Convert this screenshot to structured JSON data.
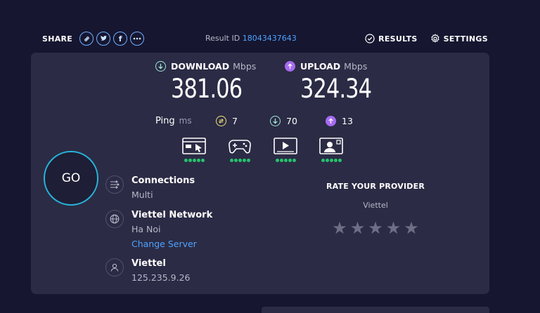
{
  "share": {
    "label": "SHARE",
    "buttons": [
      {
        "name": "link",
        "icon": "link-icon"
      },
      {
        "name": "twitter",
        "icon": "twitter-icon"
      },
      {
        "name": "facebook",
        "icon": "facebook-icon",
        "glyph": "f"
      },
      {
        "name": "more",
        "icon": "more-icon"
      }
    ]
  },
  "result": {
    "label": "Result ID",
    "id": "18043437643"
  },
  "nav": {
    "results": "RESULTS",
    "settings": "SETTINGS"
  },
  "download": {
    "label": "DOWNLOAD",
    "unit": "Mbps",
    "value": "381.06",
    "icon": "arrow-down-icon",
    "color": "#9fe8d6"
  },
  "upload": {
    "label": "UPLOAD",
    "unit": "Mbps",
    "value": "324.34",
    "icon": "arrow-up-icon",
    "color": "#c58cff"
  },
  "ping": {
    "label": "Ping",
    "unit": "ms",
    "idle": {
      "value": "7",
      "color": "#f1e37a"
    },
    "download": {
      "value": "70",
      "color": "#9fe8d6"
    },
    "upload": {
      "value": "13",
      "color": "#c58cff"
    }
  },
  "app_ratings": [
    {
      "name": "web-browsing",
      "icon": "browser-icon",
      "rating": 5,
      "max": 5
    },
    {
      "name": "gaming",
      "icon": "gamepad-icon",
      "rating": 5,
      "max": 5
    },
    {
      "name": "video-streaming",
      "icon": "video-icon",
      "rating": 5,
      "max": 5
    },
    {
      "name": "video-chat",
      "icon": "video-chat-icon",
      "rating": 5,
      "max": 5
    }
  ],
  "go_label": "GO",
  "connections": {
    "title": "Connections",
    "value": "Multi"
  },
  "server": {
    "title": "Viettel Network",
    "location": "Ha Noi",
    "change": "Change Server"
  },
  "provider": {
    "title": "Viettel",
    "ip": "125.235.9.26"
  },
  "rate": {
    "title": "RATE YOUR PROVIDER",
    "provider": "Viettel",
    "stars": 5
  },
  "colors": {
    "background": "#161630",
    "panel": "#2b2b45",
    "accent": "#4ea3ff",
    "go_ring": "#27b4d8",
    "good": "#26c26c"
  }
}
